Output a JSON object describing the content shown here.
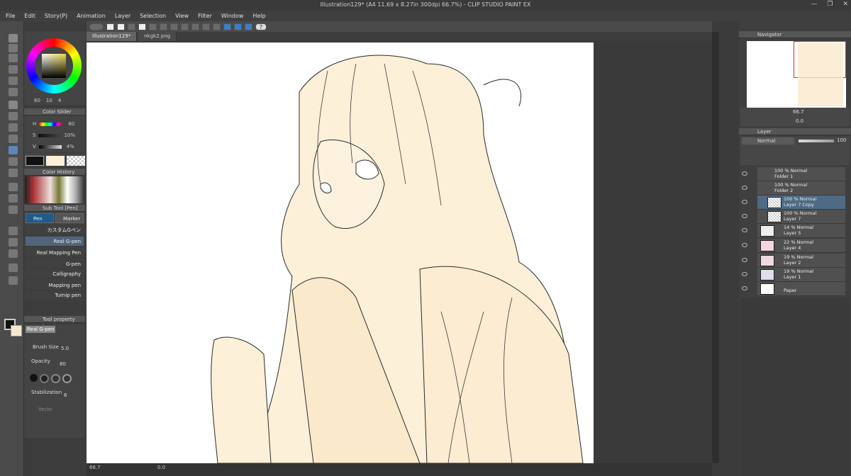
{
  "window": {
    "title": "Illustration129* (A4 11.69 x 8.27in 300dpi 66.7%) - CLIP STUDIO PAINT EX"
  },
  "menu": [
    "File",
    "Edit",
    "Story(P)",
    "Animation",
    "Layer",
    "Selection",
    "View",
    "Filter",
    "Window",
    "Help"
  ],
  "doc_tabs": [
    "Illustration129*",
    "nkgk2.png"
  ],
  "color_wheel": {
    "v1": "60",
    "v2": "10",
    "v3": "4"
  },
  "color_slider": {
    "title": "Color Slider",
    "h_label": "H",
    "h_value": "60",
    "s_label": "S",
    "s_value": "10%",
    "v_label": "V",
    "v_value": "4%"
  },
  "color_history": {
    "title": "Color History"
  },
  "sub_tool": {
    "title": "Sub Tool [Pen]",
    "tabs": [
      "Pen",
      "Marker"
    ],
    "items": [
      "カスタムGペン",
      "Real G-pen",
      "Real Mapping Pen",
      "G-pen",
      "Calligraphy",
      "Mapping pen",
      "Turnip pen"
    ],
    "selected": "Real G-pen"
  },
  "tool_property": {
    "title": "Tool property [Real",
    "tool_name": "Real G-pen",
    "brush_size_label": "Brush Size",
    "brush_size_value": "5.0",
    "opacity_label": "Opacity",
    "opacity_value": "80",
    "stabilization_label": "Stabilization",
    "stabilization_value": "6",
    "vector_label": "Vecto"
  },
  "navigator": {
    "title": "Navigator",
    "zoom": "66.7",
    "rotation": "0.0"
  },
  "layer_panel": {
    "title": "Layer",
    "blend_mode": "Normal",
    "opacity": "100",
    "layers": [
      {
        "line1": "100 % Normal",
        "line2": "Folder 1"
      },
      {
        "line1": "100 % Normal",
        "line2": "Folder 2"
      },
      {
        "line1": "100 % Normal",
        "line2": "Layer 7 Copy"
      },
      {
        "line1": "100 % Normal",
        "line2": "Layer 7"
      },
      {
        "line1": "14 % Normal",
        "line2": "Layer 5"
      },
      {
        "line1": "22 % Normal",
        "line2": "Layer 4"
      },
      {
        "line1": "19 % Normal",
        "line2": "Layer 2"
      },
      {
        "line1": "19 % Normal",
        "line2": "Layer 1"
      },
      {
        "line1": "",
        "line2": "Paper"
      }
    ]
  },
  "status": {
    "zoom": "66.7",
    "rotation": "0.0"
  },
  "colors": {
    "accent": "#3a7fc6",
    "lineart_fill": "#fdf0d8",
    "selected_layer": "#4e6a84"
  }
}
